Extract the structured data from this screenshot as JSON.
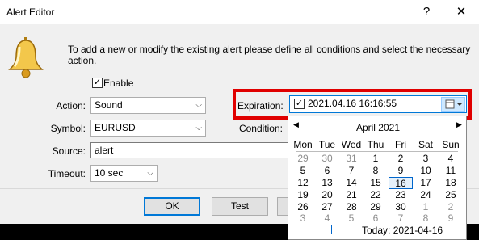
{
  "window": {
    "title": "Alert Editor",
    "help_glyph": "?",
    "close_glyph": "✕"
  },
  "intro_text": "To add a new or modify the existing alert please define all conditions and select the necessary action.",
  "enable": {
    "label": "Enable",
    "checked": true
  },
  "action": {
    "label": "Action:",
    "value": "Sound"
  },
  "symbol": {
    "label": "Symbol:",
    "value": "EURUSD"
  },
  "source": {
    "label": "Source:",
    "value": "alert"
  },
  "timeout": {
    "label": "Timeout:",
    "value": "10 sec"
  },
  "expiration": {
    "label": "Expiration:",
    "value": "2021.04.16 16:16:55",
    "checked": true
  },
  "condition": {
    "label": "Condition:"
  },
  "buttons": {
    "ok": "OK",
    "test": "Test"
  },
  "calendar": {
    "month": "April 2021",
    "prev": "◀",
    "next": "▶",
    "weekdays": [
      "Mon",
      "Tue",
      "Wed",
      "Thu",
      "Fri",
      "Sat",
      "Sun"
    ],
    "weeks": [
      [
        "29",
        "30",
        "31",
        "1",
        "2",
        "3",
        "4"
      ],
      [
        "5",
        "6",
        "7",
        "8",
        "9",
        "10",
        "11"
      ],
      [
        "12",
        "13",
        "14",
        "15",
        "16",
        "17",
        "18"
      ],
      [
        "19",
        "20",
        "21",
        "22",
        "23",
        "24",
        "25"
      ],
      [
        "26",
        "27",
        "28",
        "29",
        "30",
        "1",
        "2"
      ],
      [
        "3",
        "4",
        "5",
        "6",
        "7",
        "8",
        "9"
      ]
    ],
    "selected": "16",
    "today_label": "Today: 2021-04-16"
  },
  "colors": {
    "accent": "#0078d7",
    "highlight": "#e00000"
  },
  "icons": [
    "bell-icon",
    "chevron-down-icon",
    "calendar-icon",
    "checkbox-icon"
  ]
}
